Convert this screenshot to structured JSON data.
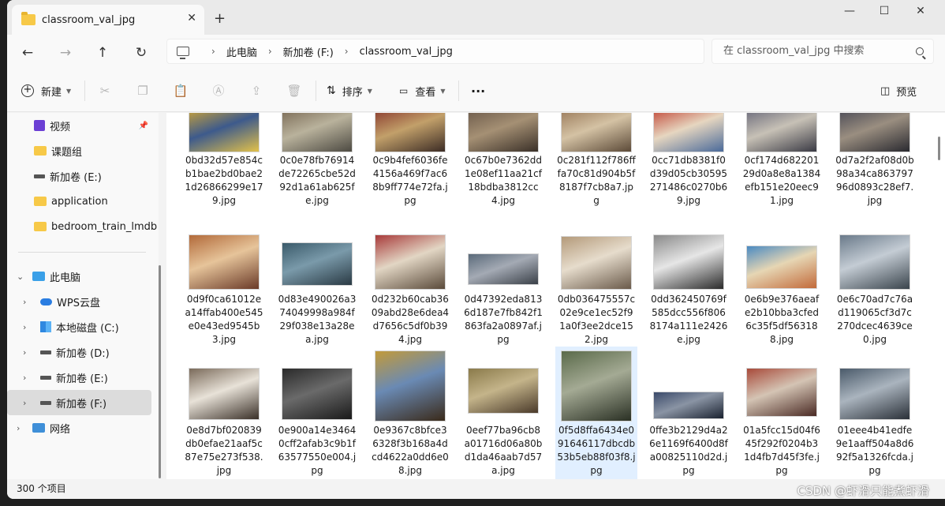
{
  "window": {
    "tab_title": "classroom_val_jpg",
    "new_tab": "+",
    "close_tab": "✕",
    "minimize": "—",
    "maximize": "☐",
    "close": "✕"
  },
  "nav": {
    "back": "←",
    "forward": "→",
    "up": "↑",
    "refresh": "↻"
  },
  "breadcrumb": [
    "此电脑",
    "新加卷 (F:)",
    "classroom_val_jpg"
  ],
  "breadcrumb_sep": "›",
  "search": {
    "placeholder": "在 classroom_val_jpg 中搜索"
  },
  "toolbar": {
    "new_label": "新建",
    "sort_label": "排序",
    "view_label": "查看",
    "more": "···",
    "preview_label": "预览"
  },
  "sidebar": {
    "quick_access": [
      {
        "label": "视频",
        "icon": "video-folder-icon",
        "pinned": true
      },
      {
        "label": "课题组",
        "icon": "folder-icon"
      },
      {
        "label": "新加卷 (E:)",
        "icon": "drive-icon"
      },
      {
        "label": "application",
        "icon": "folder-icon"
      },
      {
        "label": "bedroom_train_lmdb",
        "icon": "folder-icon"
      }
    ],
    "tree": [
      {
        "label": "此电脑",
        "icon": "pc-icon",
        "expanded": true
      },
      {
        "label": "WPS云盘",
        "icon": "cloud-icon"
      },
      {
        "label": "本地磁盘 (C:)",
        "icon": "windows-drive-icon"
      },
      {
        "label": "新加卷 (D:)",
        "icon": "drive-icon"
      },
      {
        "label": "新加卷 (E:)",
        "icon": "drive-icon"
      },
      {
        "label": "新加卷 (F:)",
        "icon": "drive-icon",
        "selected": true
      },
      {
        "label": "网络",
        "icon": "network-icon"
      }
    ]
  },
  "files": [
    {
      "name": "0bd32d57e854cb1bae2bd0bae21d26866299e179.jpg"
    },
    {
      "name": "0c0e78fb76914de72265cbe52d92d1a61ab625fe.jpg"
    },
    {
      "name": "0c9b4fef6036fe4156a469f7ac68b9ff774e72fa.jpg"
    },
    {
      "name": "0c67b0e7362dd1e08ef11aa21cf18bdba3812cc4.jpg"
    },
    {
      "name": "0c281f112f786fffa70c81d904b5f8187f7cb8a7.jpg"
    },
    {
      "name": "0cc71db8381f0d39d05cb30595271486c0270b69.jpg"
    },
    {
      "name": "0cf174d682201 29d0a8e8a1384efb151e20eec91.jpg"
    },
    {
      "name": "0d7a2f2af08d0b98a34ca86379796d0893c28ef7.jpg"
    },
    {
      "name": "0d9f0ca61012ea14ffab400e545e0e43ed9545b3.jpg"
    },
    {
      "name": "0d83e490026a374049998a984f29f038e13a28ea.jpg"
    },
    {
      "name": "0d232b60cab3609abd28e6dea4d7656c5df0b394.jpg"
    },
    {
      "name": "0d47392eda8136d187e7fb842f1863fa2a0897af.jpg"
    },
    {
      "name": "0db036475557c02e9ce1ec52f91a0f3ee2dce152.jpg"
    },
    {
      "name": "0dd362450769f585dcc556f8068174a111e2426e.jpg"
    },
    {
      "name": "0e6b9e376aeafe2b10bba3cfed6c35f5df563188.jpg"
    },
    {
      "name": "0e6c70ad7c76ad119065cf3d7c270dcec4639ce0.jpg"
    },
    {
      "name": "0e8d7bf020839db0efae21aaf5c87e75e273f538.jpg"
    },
    {
      "name": "0e900a14e34640cff2afab3c9b1f63577550e004.jpg"
    },
    {
      "name": "0e9367c8bfce36328f3b168a4dcd4622a0dd6e08.jpg"
    },
    {
      "name": "0eef77ba96cb8a01716d06a80bd1da46aab7d57a.jpg"
    },
    {
      "name": "0f5d8ffa6434e091646117dbcdb53b5eb88f03f8.jpg",
      "selected": true
    },
    {
      "name": "0ffe3b2129d4a26e1169f6400d8fa00825110d2d.jpg"
    },
    {
      "name": "01a5fcc15d04f645f292f0204b31d4fb7d45f3fe.jpg"
    },
    {
      "name": "01eee4b41edfe9e1aaff504a8d692f5a1326fcda.jpg"
    }
  ],
  "status": {
    "count": "300 个项目"
  },
  "watermark": "CSDN @虾滑只能煮虾滑"
}
